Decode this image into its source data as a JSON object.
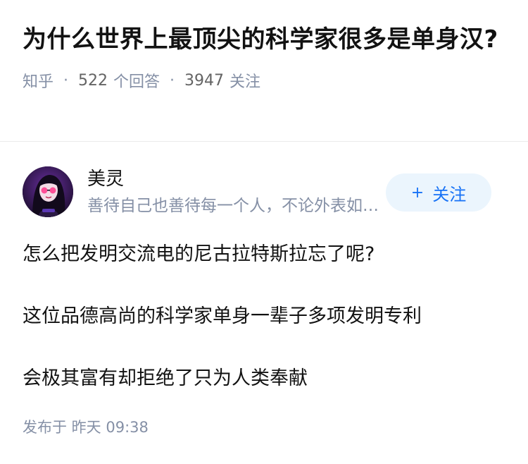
{
  "question": {
    "title": "为什么世界上最顶尖的科学家很多是单身汉?",
    "site": "知乎",
    "answer_count": "522",
    "answer_unit": "个回答",
    "follower_count": "3947",
    "follower_unit": "关注",
    "separator": "·"
  },
  "author": {
    "name": "美灵",
    "bio": "善待自己也善待每一个人，不论外表如何美丽",
    "follow_label": "关注",
    "follow_plus": "+"
  },
  "answer": {
    "paragraphs": [
      "怎么把发明交流电的尼古拉特斯拉忘了呢?",
      "这位品德高尚的科学家单身一辈子多项发明专利",
      "会极其富有却拒绝了只为人类奉献"
    ],
    "published": "发布于  昨天 09:38"
  },
  "colors": {
    "title": "#121212",
    "meta": "#8590a6",
    "accent": "#1772f6",
    "follow_bg": "#ebf5fd"
  }
}
